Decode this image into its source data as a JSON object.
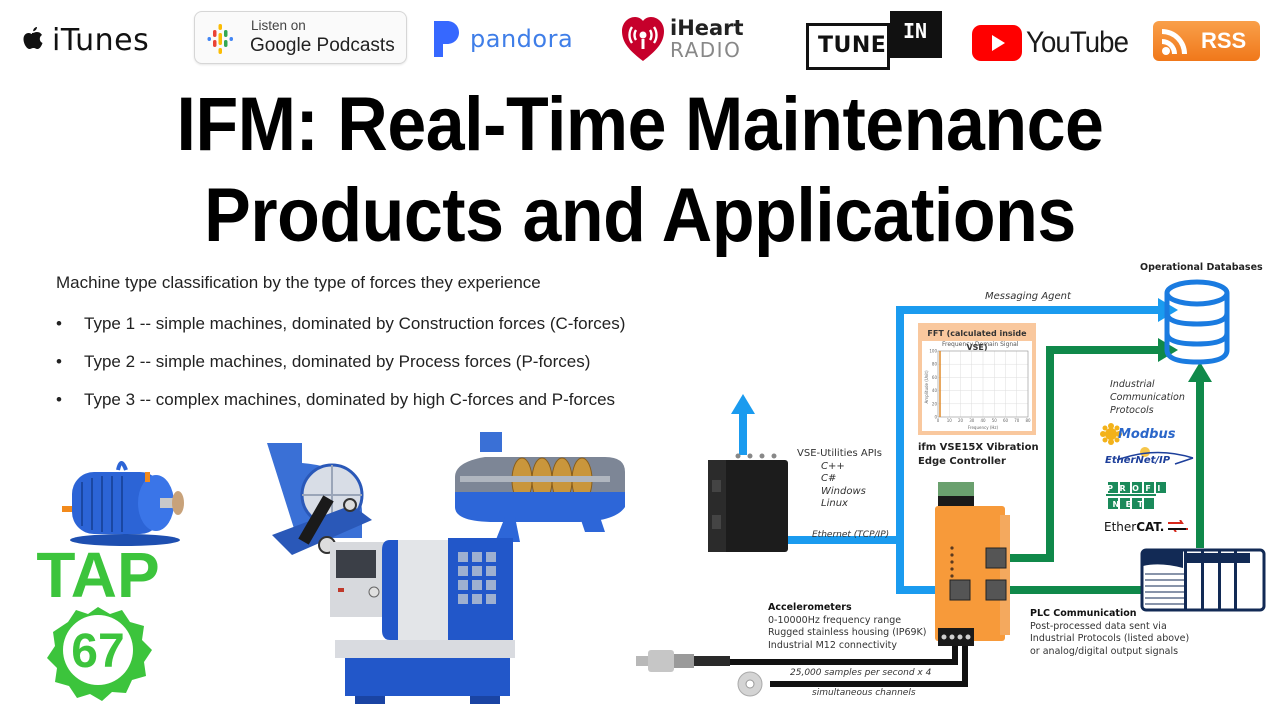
{
  "logos": {
    "itunes": "iTunes",
    "google_podcasts": {
      "line1": "Listen on",
      "line2": "Google Podcasts"
    },
    "pandora": "pandora",
    "iheart": {
      "line1": "iHeart",
      "line2": "RADIO"
    },
    "tunein": {
      "left": "TUNE",
      "right": "IN"
    },
    "youtube": "YouTube",
    "rss": "RSS"
  },
  "title": {
    "line1": "IFM: Real-Time Maintenance",
    "line2": "Products and Applications"
  },
  "content": {
    "intro": "Machine type classification by the type of forces they experience",
    "bullet_glyph": "•",
    "bullets": [
      "Type 1 -- simple machines, dominated by Construction forces (C-forces)",
      "Type 2 -- simple machines, dominated by Process forces (P-forces)",
      "Type 3 -- complex machines, dominated by high C-forces and P-forces"
    ]
  },
  "badge": {
    "line1": "TAP",
    "line2": "67",
    "color": "#3cc43c"
  },
  "diagram": {
    "operational_databases": "Operational Databases",
    "messaging_agent": "Messaging Agent",
    "fft": {
      "header": "FFT (calculated inside VSE)",
      "chart_title": "Frequency Domain Signal",
      "ylabel": "Amplitude (Unit)",
      "xlabel": "Frequency (Hz)",
      "yticks": [
        "0",
        "20",
        "40",
        "60",
        "80",
        "100"
      ],
      "xticks": [
        "0",
        "10",
        "20",
        "30",
        "40",
        "50",
        "60",
        "70",
        "80"
      ]
    },
    "vse_title_line1": "ifm VSE15X Vibration",
    "vse_title_line2": "Edge Controller",
    "apis": {
      "title": "VSE-Utilities APIs",
      "items": [
        "C++",
        "C#",
        "Windows",
        "Linux"
      ]
    },
    "ethernet": "Ethernet (TCP/IP)",
    "protocols": {
      "title_lines": [
        "Industrial",
        "Communication",
        "Protocols"
      ],
      "modbus": "Modbus",
      "ethernetip": "EtherNet/IP",
      "profinet_top": "PROFI",
      "profinet_bottom": "NET",
      "ethercat_a": "Ether",
      "ethercat_b": "CAT."
    },
    "accelerometers": {
      "title": "Accelerometers",
      "lines": [
        "0-10000Hz frequency range",
        "Rugged stainless housing (IP69K)",
        "Industrial M12 connectivity"
      ]
    },
    "samples": "25,000  samples per second  x  4",
    "channels": "simultaneous channels",
    "plc": {
      "title": "PLC Communication",
      "lines": [
        "Post-processed data sent via",
        "Industrial Protocols (listed above)",
        "or analog/digital output signals"
      ]
    },
    "colors": {
      "blue": "#1a9bef",
      "green": "#10894a",
      "orange": "#f79a3a"
    }
  }
}
